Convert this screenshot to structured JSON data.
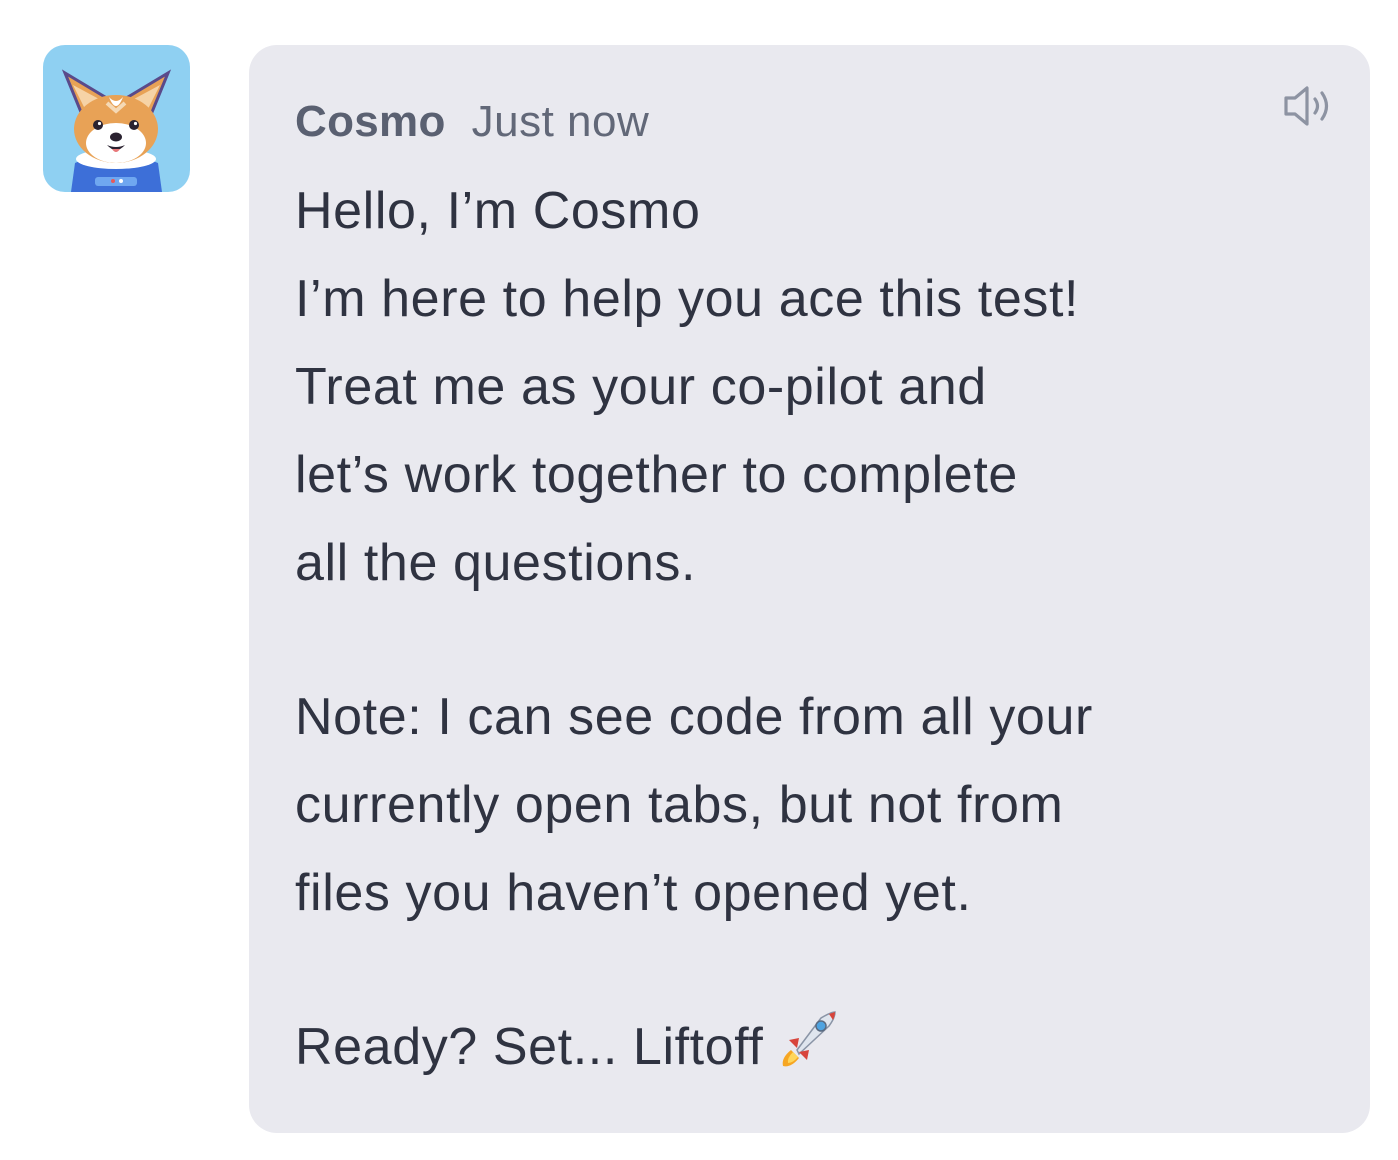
{
  "chat": {
    "sender": "Cosmo",
    "timestamp": "Just now",
    "avatar_icon": "corgi-astronaut-avatar",
    "speaker_icon": "speaker-icon",
    "message": {
      "paragraph1": [
        "Hello, I’m Cosmo",
        "I’m here to help you ace this test!",
        "Treat me as your co-pilot and",
        "let’s work together to complete",
        "all the questions."
      ],
      "paragraph2": [
        "Note: I can see code from all your",
        "currently open tabs, but not from",
        "files you haven’t opened yet."
      ],
      "paragraph3": "Ready? Set... Liftoff",
      "emoji_icon": "rocket-icon"
    }
  },
  "colors": {
    "avatar_bg": "#8fd0f2",
    "bubble_bg": "#e9e9ef",
    "text": "#2f3341",
    "meta_text": "#5a6071"
  }
}
